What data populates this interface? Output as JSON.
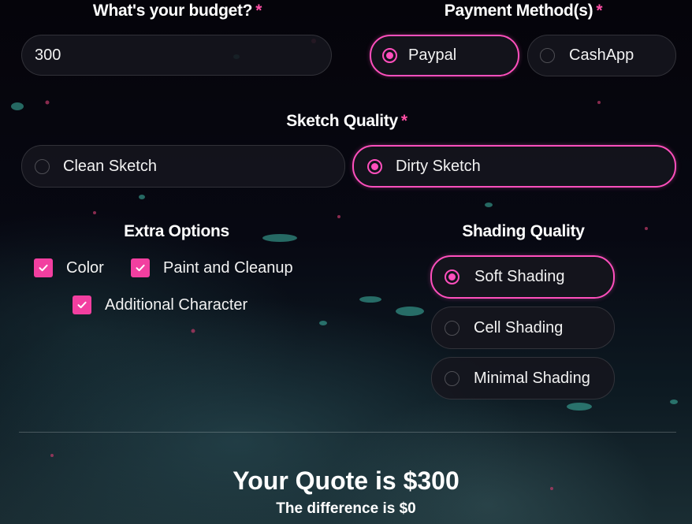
{
  "budget": {
    "label": "What's your budget?",
    "required_mark": "*",
    "value": "300"
  },
  "payment": {
    "label": "Payment Method(s)",
    "required_mark": "*",
    "options": [
      "Paypal",
      "CashApp"
    ],
    "selected": "Paypal"
  },
  "sketch": {
    "label": "Sketch Quality",
    "required_mark": "*",
    "options": [
      "Clean Sketch",
      "Dirty Sketch"
    ],
    "selected": "Dirty Sketch"
  },
  "extras": {
    "label": "Extra Options",
    "options": [
      "Color",
      "Paint and Cleanup",
      "Additional Character"
    ],
    "checked": [
      true,
      true,
      true
    ]
  },
  "shading": {
    "label": "Shading Quality",
    "options": [
      "Soft Shading",
      "Cell Shading",
      "Minimal Shading"
    ],
    "selected": "Soft Shading"
  },
  "quote": {
    "text": "Your Quote is $300",
    "difference": "The difference is $0"
  },
  "colors": {
    "accent": "#ff4fbd",
    "checkbox": "#f23fa0",
    "required": "#ff4fa6"
  }
}
